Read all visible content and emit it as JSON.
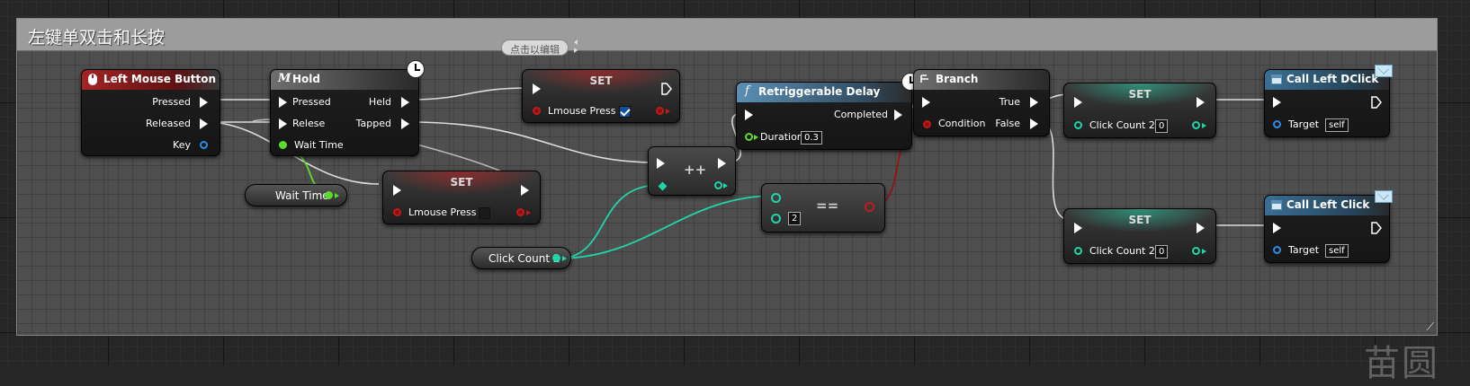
{
  "comment": {
    "title": "左键单双击和长按"
  },
  "watermark": "苗圆",
  "tooltip": {
    "text": "点击以编辑"
  },
  "nodes": {
    "left_mouse_button": {
      "title": "Left Mouse Button",
      "pins": {
        "pressed": "Pressed",
        "released": "Released",
        "key": "Key"
      }
    },
    "hold": {
      "title": "Hold",
      "pins": {
        "pressed": "Pressed",
        "relese": "Relese",
        "wait_time": "Wait Time",
        "held": "Held",
        "tapped": "Tapped"
      }
    },
    "wait_time_var": {
      "label": "Wait Time"
    },
    "set_press_true": {
      "title": "SET",
      "var_label": "Lmouse Press",
      "checked": true
    },
    "set_press_false": {
      "title": "SET",
      "var_label": "Lmouse Press",
      "checked": false
    },
    "increment": {
      "label": "++"
    },
    "click_count_var": {
      "label": "Click Count 2"
    },
    "equals": {
      "label": "==",
      "value": "2"
    },
    "retriggerable_delay": {
      "title": "Retriggerable Delay",
      "pins": {
        "completed": "Completed",
        "duration": "Duration"
      },
      "duration_value": "0.3"
    },
    "branch": {
      "title": "Branch",
      "pins": {
        "condition": "Condition",
        "true": "True",
        "false": "False"
      }
    },
    "set_count_true": {
      "title": "SET",
      "var_label": "Click Count 2",
      "value": "0"
    },
    "set_count_false": {
      "title": "SET",
      "var_label": "Click Count 2",
      "value": "0"
    },
    "call_left_dclick": {
      "title": "Call Left DClick",
      "target_label": "Target",
      "target_value": "self"
    },
    "call_left_click": {
      "title": "Call Left Click",
      "target_label": "Target",
      "target_value": "self"
    }
  },
  "colors": {
    "event_header": "#a52424",
    "exec_wire": "#ffffff",
    "float_pin": "#5ddc2b",
    "int_pin": "#20d5a8",
    "bool_pin": "#c21a1a",
    "object_pin": "#2a8ee8",
    "comment_header": "#9c9c9c"
  }
}
